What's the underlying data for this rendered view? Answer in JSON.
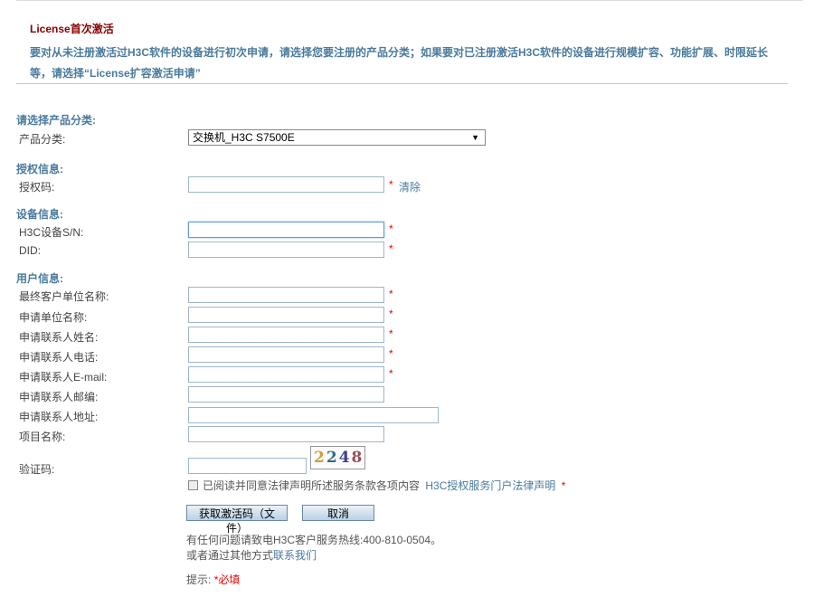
{
  "header": {
    "title": "License首次激活",
    "desc_line1": "要对从未注册激活过H3C软件的设备进行初次申请，请选择您要注册的产品分类；如果要对已注册激活H3C软件的设备进行规模扩容、功能扩展、时限延长",
    "desc_line2": "等，请选择“License扩容激活申请”"
  },
  "product": {
    "section": "请选择产品分类:",
    "label": "产品分类:",
    "selected": "交换机_H3C S7500E",
    "arrow_icon": "triangle-down-icon"
  },
  "auth": {
    "section": "授权信息:",
    "code_label": "授权码:",
    "code_value": "",
    "clear_link": "清除"
  },
  "device": {
    "section": "设备信息:",
    "sn_label": "H3C设备S/N:",
    "sn_value": "",
    "did_label": "DID:",
    "did_value": ""
  },
  "user": {
    "section": "用户信息:",
    "end_customer_label": "最终客户单位名称:",
    "applicant_org_label": "申请单位名称:",
    "contact_name_label": "申请联系人姓名:",
    "contact_phone_label": "申请联系人电话:",
    "contact_email_label": "申请联系人E-mail:",
    "contact_zip_label": "申请联系人邮编:",
    "contact_addr_label": "申请联系人地址:",
    "project_label": "项目名称:"
  },
  "captcha": {
    "label": "验证码:",
    "value": "",
    "digits": [
      "2",
      "2",
      "4",
      "8"
    ]
  },
  "agreement": {
    "text": "已阅读并同意法律声明所述服务条款各项内容",
    "link": "H3C授权服务门户法律声明",
    "checked": false
  },
  "buttons": {
    "submit": "获取激活码（文件）",
    "cancel": "取消"
  },
  "footer": {
    "hotline": "有任何问题请致电H3C客户服务热线:400-810-0504。",
    "other_prefix": "或者通过其他方式",
    "contact_link": "联系我们",
    "hint_label": "提示:",
    "hint_required": "*必填"
  },
  "required_mark": "*",
  "colors": {
    "title": "#8b0000",
    "section": "#4a7a9c",
    "required": "#e00000",
    "link": "#4a7a9c"
  }
}
